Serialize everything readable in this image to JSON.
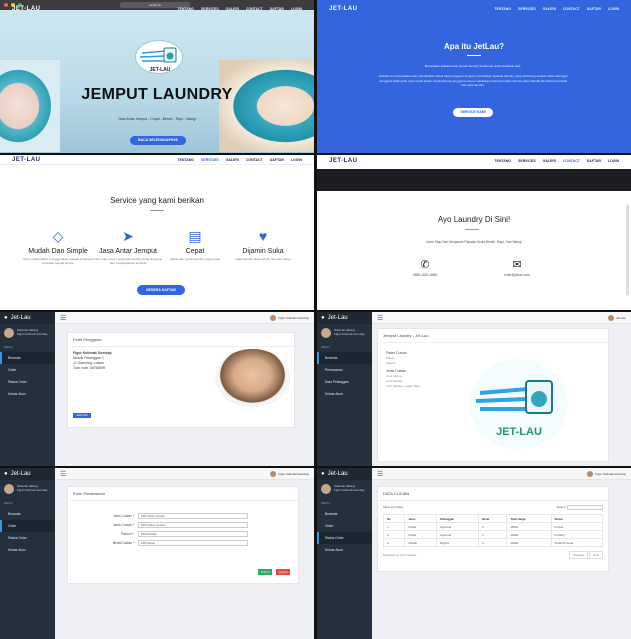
{
  "nav": {
    "brand": "JET-LAU",
    "items": [
      "TENTANG",
      "SERVICES",
      "GALERI",
      "CONTACT",
      "DAFTAR",
      "LOGIN"
    ]
  },
  "browser": {
    "url": "localhost"
  },
  "hero": {
    "logo_text": "JET-LAU",
    "title": "JEMPUT LAUNDRY",
    "subtitle": "Jasa Antar Jemput - Cepat - Bersih - Rapi - Wangi",
    "cta": "BACA SELENGKAPNYA"
  },
  "about": {
    "title": "Apa itu JetLau?",
    "p1": "Merupakan aplikasi antar jemput laundry berbentuk online berbasis web.",
    "p2": "Aplikasi ini menyediakan dan memberikan solusi bagi pengguna dengan memberikan layanan laundry yang terhubung secara online sehingga pengguna tidak perlu repot untuk keluar rumah karena pengguna hanya melakukan order kemudian laundry akan diambil dan diantar kembali oleh jasa laundry.",
    "button": "SERVICE KAMI"
  },
  "services": {
    "title": "Service yang kami berikan",
    "items": [
      {
        "name": "Mudah Dan Simple",
        "desc": "User mudah dalam menggunakan aplikasi ini karena di desain sangat simple"
      },
      {
        "name": "Jasa Antar Jemput",
        "desc": "Kami siap untuk menjemput laundry anda langsung dan mengantarkan kembali"
      },
      {
        "name": "Cepat",
        "desc": "Waktu dan proses laundry yang cepat"
      },
      {
        "name": "Dijamin Suka",
        "desc": "Hasil laundry akan bersih, rapi dan wangi"
      }
    ],
    "button": "SEGERA DAFTAR"
  },
  "contact": {
    "title": "Ayo Laundry Di Sini!",
    "subtitle": "Kami Siap Dan Menjamin Pakaian Anda Bersih, Rapi, Dan Wangi",
    "phone": "0896-1651-8988",
    "email": "order@jetlau.com"
  },
  "admin": {
    "app_name": "Jet-Lau",
    "user_name": "Figur Kolimatt Gombay",
    "user_role": "Selamat datang",
    "section": "MENU",
    "menu": [
      "Beranda",
      "Order",
      "Status Order",
      "Keluar Akun"
    ],
    "menu_alt": [
      "Beranda",
      "Pemesanan",
      "Data Pelanggan",
      "Keluar Akun"
    ]
  },
  "profile": {
    "panel_title": "Profil Pengguna",
    "name": "Figur Kolimatt Gombay",
    "line1": "Masuk Pelanggan 1",
    "line2": "Jl. Gamnlog, Lokasi",
    "line3": "Turfi orab, 08766699",
    "button": "Edit Profil"
  },
  "dashboard": {
    "panel_title": "Jemput Laundry - Jet-Lau",
    "box_title": "Paket Cucian",
    "box_items": [
      "Kiloan",
      "Satuan"
    ],
    "box_title2": "Jenis Cucian",
    "box_items2": [
      "Cuci Kering",
      "Cuci Setrika",
      "Cuci Setrika + Lipat, Rapi"
    ],
    "logo_text": "JET-LAU"
  },
  "order_form": {
    "title": "Form Pemesanan",
    "fields": [
      {
        "label": "Jenis Cucian *",
        "value": "Pilih Jenis Cucian"
      },
      {
        "label": "Jenis Cucian *",
        "value": "Pilih Paket Cucian"
      },
      {
        "label": "Parfum *",
        "value": "Pilih Parfum"
      },
      {
        "label": "Berat Cucian *",
        "value": "Pilih Berat"
      }
    ],
    "submit": "Submit",
    "cancel": "Cancel"
  },
  "data_table": {
    "title": "DATA CUCIAN",
    "show": "Show 10 entries",
    "search": "Search:",
    "headers": [
      "No",
      "Jenis",
      "Pelanggan",
      "Berat",
      "Total Harga",
      "Status"
    ],
    "rows": [
      [
        "1",
        "Kiloan",
        "Agusmar",
        "3",
        "15000",
        "Proses"
      ],
      [
        "2",
        "Kiloan",
        "Agusmar",
        "2",
        "10000",
        "Pending"
      ],
      [
        "3",
        "Satuan",
        "Regina",
        "4",
        "20000",
        "Sudah Di Antar"
      ]
    ],
    "footer": "Showing 1 to 3 of 3 entries",
    "prev": "Previous",
    "next": "Next"
  }
}
